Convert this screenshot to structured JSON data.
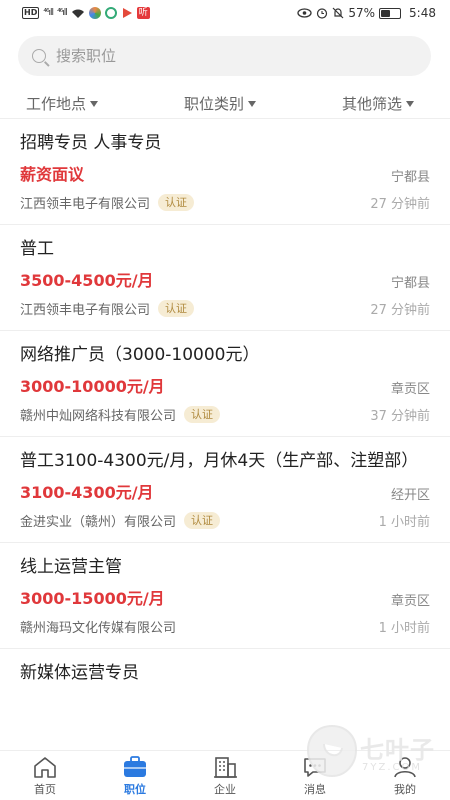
{
  "status_bar": {
    "carrier_chip": "HD",
    "signal1": "⁴⁶ıll",
    "signal2": "⁴⁶ıll",
    "app_badge": "听",
    "battery_text": "57%",
    "time": "5:48",
    "battery_level": 0.57
  },
  "search": {
    "placeholder": "搜索职位"
  },
  "filters": [
    {
      "label": "工作地点"
    },
    {
      "label": "职位类别"
    },
    {
      "label": "其他筛选"
    }
  ],
  "jobs": [
    {
      "title": "招聘专员 人事专员",
      "salary": "薪资面议",
      "location": "宁都县",
      "company": "江西领丰电子有限公司",
      "badge": "认证",
      "time": "27 分钟前"
    },
    {
      "title": "普工",
      "salary": "3500-4500元/月",
      "location": "宁都县",
      "company": "江西领丰电子有限公司",
      "badge": "认证",
      "time": "27 分钟前"
    },
    {
      "title": "网络推广员（3000-10000元）",
      "salary": "3000-10000元/月",
      "location": "章贡区",
      "company": "赣州中灿网络科技有限公司",
      "badge": "认证",
      "time": "37 分钟前"
    },
    {
      "title": "普工3100-4300元/月，月休4天（生产部、注塑部）",
      "salary": "3100-4300元/月",
      "location": "经开区",
      "company": "金进实业（赣州）有限公司",
      "badge": "认证",
      "time": "1 小时前"
    },
    {
      "title": "线上运营主管",
      "salary": "3000-15000元/月",
      "location": "章贡区",
      "company": "赣州海玛文化传媒有限公司",
      "badge": "",
      "time": "1 小时前"
    },
    {
      "title": "新媒体运营专员",
      "salary": "",
      "location": "",
      "company": "",
      "badge": "",
      "time": ""
    }
  ],
  "tabs": [
    {
      "label": "首页",
      "icon": "home-icon",
      "active": false
    },
    {
      "label": "职位",
      "icon": "briefcase-icon",
      "active": true
    },
    {
      "label": "企业",
      "icon": "building-icon",
      "active": false
    },
    {
      "label": "消息",
      "icon": "chat-icon",
      "active": false
    },
    {
      "label": "我的",
      "icon": "user-icon",
      "active": false
    }
  ],
  "watermark": {
    "text": "七叶子",
    "sub": "7YZ.COM"
  },
  "colors": {
    "accent": "#2b7ae0",
    "salary": "#e0383b",
    "badge_text": "#b08a3e",
    "badge_bg": "#f6ecd4"
  }
}
